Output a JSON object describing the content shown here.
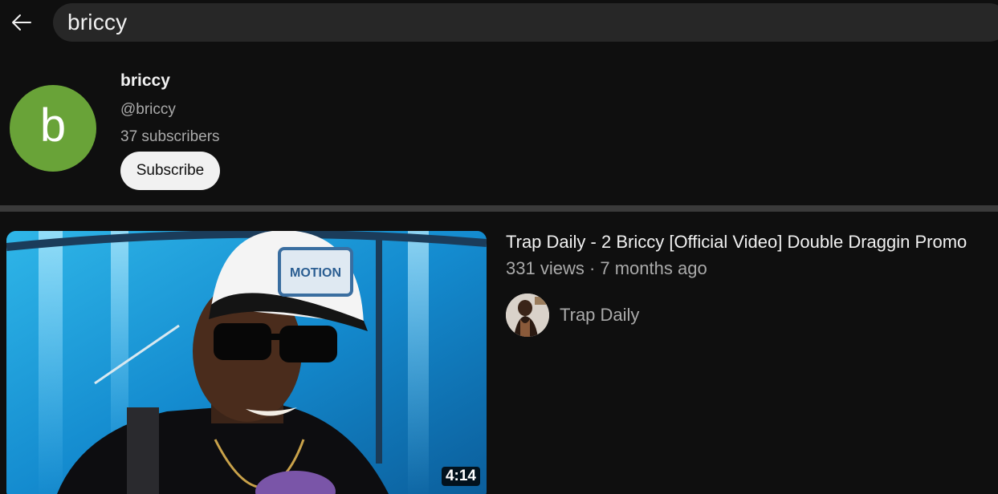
{
  "header": {
    "back_icon": "arrow-left-icon",
    "search": {
      "query": "briccy"
    }
  },
  "channel": {
    "avatar_letter": "b",
    "avatar_color": "#69a338",
    "name": "briccy",
    "handle": "@briccy",
    "subscribers": "37 subscribers",
    "subscribe_label": "Subscribe"
  },
  "video": {
    "title": "Trap Daily - 2 Briccy [Official Video] Double Draggin Promo",
    "meta": "331 views · 7 months ago",
    "channel_name": "Trap Daily",
    "duration": "4:14"
  },
  "colors": {
    "background": "#0f0f0f",
    "search_bg": "#272727",
    "divider": "#3a3a3a",
    "secondary_text": "#aaaaaa"
  }
}
